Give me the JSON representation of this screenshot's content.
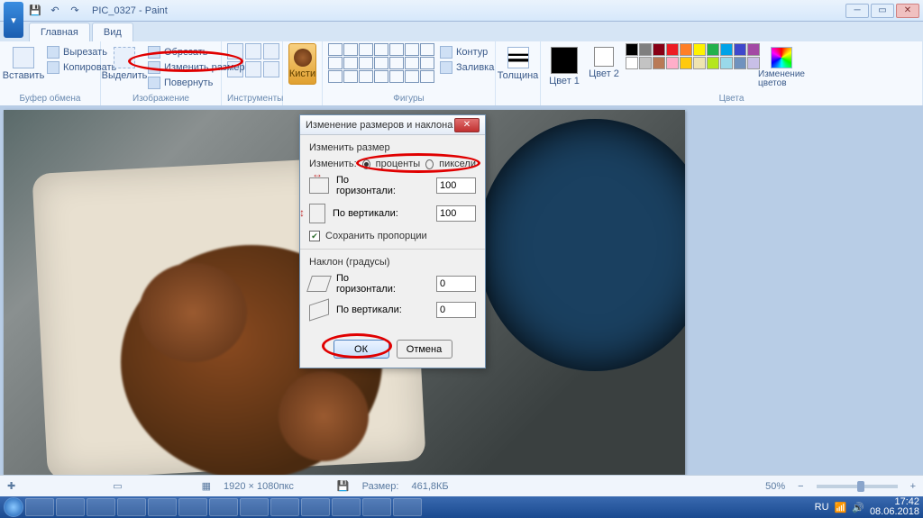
{
  "titlebar": {
    "doc": "PIC_0327",
    "app": "Paint"
  },
  "tabs": {
    "home": "Главная",
    "view": "Вид"
  },
  "ribbon": {
    "clipboard": {
      "label": "Буфер обмена",
      "paste": "Вставить",
      "cut": "Вырезать",
      "copy": "Копировать"
    },
    "image": {
      "label": "Изображение",
      "select": "Выделить",
      "crop": "Обрезать",
      "resize": "Изменить размер",
      "rotate": "Повернуть"
    },
    "tools": {
      "label": "Инструменты"
    },
    "brushes": {
      "label": "Кисти"
    },
    "shapes": {
      "label": "Фигуры",
      "outline": "Контур",
      "fill": "Заливка"
    },
    "thickness": {
      "label": "Толщина"
    },
    "colors": {
      "label": "Цвета",
      "color1": "Цвет 1",
      "color2": "Цвет 2",
      "edit": "Изменение цветов"
    },
    "palette": [
      "#000000",
      "#7f7f7f",
      "#880015",
      "#ed1c24",
      "#ff7f27",
      "#fff200",
      "#22b14c",
      "#00a2e8",
      "#3f48cc",
      "#a349a4",
      "#ffffff",
      "#c3c3c3",
      "#b97a57",
      "#ffaec9",
      "#ffc90e",
      "#efe4b0",
      "#b5e61d",
      "#99d9ea",
      "#7092be",
      "#c8bfe7"
    ]
  },
  "dialog": {
    "title": "Изменение размеров и наклона",
    "resize_section": "Изменить размер",
    "by_label": "Изменить:",
    "percent": "проценты",
    "pixels": "пиксели",
    "horiz_label1": "По",
    "horiz_label2": "горизонтали:",
    "vert_label": "По вертикали:",
    "horiz_val": "100",
    "vert_val": "100",
    "keep_aspect": "Сохранить пропорции",
    "skew_section": "Наклон (градусы)",
    "skew_h_val": "0",
    "skew_v_val": "0",
    "ok": "ОК",
    "cancel": "Отмена"
  },
  "status": {
    "dims": "1920 × 1080пкс",
    "size_label": "Размер:",
    "size": "461,8КБ",
    "zoom": "50%",
    "minus": "−",
    "plus": "+"
  },
  "tray": {
    "lang": "RU",
    "time": "17:42",
    "date": "08.06.2018"
  }
}
